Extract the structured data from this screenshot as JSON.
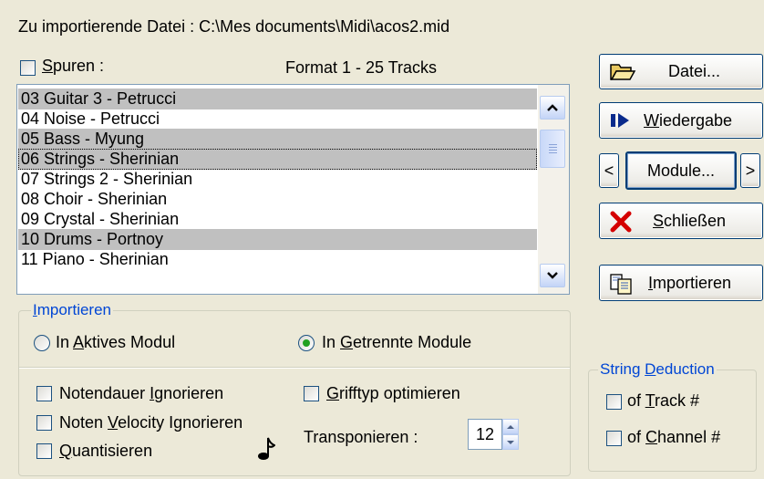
{
  "header": {
    "file_label": "Zu importierende Datei : C:\\Mes documents\\Midi\\acos2.mid",
    "format_label": "Format 1 - 25 Tracks"
  },
  "spuren": {
    "mnemonic": "S",
    "rest": "puren :",
    "checked": false
  },
  "tracks": [
    {
      "label": "03 Guitar 3  - Petrucci",
      "selected": true,
      "focused": false
    },
    {
      "label": "04 Noise - Petrucci",
      "selected": false,
      "focused": false
    },
    {
      "label": "05 Bass - Myung",
      "selected": true,
      "focused": false
    },
    {
      "label": "06 Strings - Sherinian",
      "selected": true,
      "focused": true
    },
    {
      "label": "07 Strings 2 - Sherinian",
      "selected": false,
      "focused": false
    },
    {
      "label": "08 Choir - Sherinian",
      "selected": false,
      "focused": false
    },
    {
      "label": "09 Crystal - Sherinian",
      "selected": false,
      "focused": false
    },
    {
      "label": "10 Drums - Portnoy",
      "selected": true,
      "focused": false
    },
    {
      "label": "11 Piano - Sherinian",
      "selected": false,
      "focused": false
    }
  ],
  "buttons": {
    "datei": "Datei...",
    "wiedergabe_mn": "W",
    "wiedergabe_rest": "iedergabe",
    "module": "Module...",
    "prev": "<",
    "next": ">",
    "schliessen_mn": "S",
    "schliessen_rest": "chließen",
    "importieren_mn": "I",
    "importieren_rest": "mportieren"
  },
  "import_group": {
    "title_mn": "I",
    "title_rest": "mportieren",
    "aktives_pre": "In ",
    "aktives_mn": "A",
    "aktives_rest": "ktives Modul",
    "aktives_checked": false,
    "getrennte_pre": "In ",
    "getrennte_mn": "G",
    "getrennte_rest": "etrennte Module",
    "getrennte_checked": true
  },
  "options": {
    "notendauer_pre": "Notendauer ",
    "notendauer_mn": "I",
    "notendauer_rest": "gnorieren",
    "notendauer_checked": false,
    "velocity_pre": "Noten ",
    "velocity_mn": "V",
    "velocity_rest": "elocity Ignorieren",
    "velocity_checked": false,
    "quantisieren_mn": "Q",
    "quantisieren_rest": "uantisieren",
    "quantisieren_checked": false,
    "grifftyp_mn": "G",
    "grifftyp_rest": "rifftyp optimieren",
    "grifftyp_checked": false,
    "transponieren_label": "Transponieren :",
    "transponieren_value": "12"
  },
  "string_deduction": {
    "title_pre": "String ",
    "title_mn": "D",
    "title_rest": "eduction",
    "track_pre": "of ",
    "track_mn": "T",
    "track_rest": "rack #",
    "track_checked": false,
    "channel_pre": "of ",
    "channel_mn": "C",
    "channel_rest": "hannel #",
    "channel_checked": false
  },
  "icons": {
    "datei": "folder-open-icon",
    "wiedergabe": "play-icon",
    "schliessen": "red-x-icon",
    "importieren": "import-document-icon",
    "note": "music-note-icon"
  },
  "colors": {
    "background": "#ECE9D8",
    "group_label": "#0046D5",
    "selection": "#C0C0C0",
    "close_x": "#D40000"
  }
}
